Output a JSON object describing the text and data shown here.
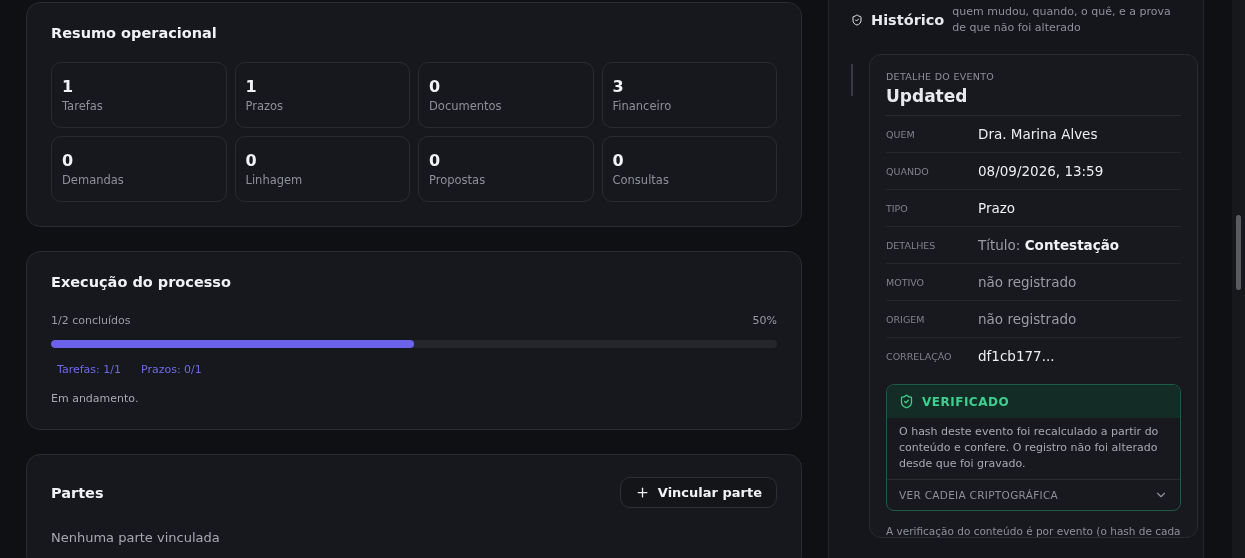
{
  "summary": {
    "title": "Resumo operacional",
    "stats": [
      {
        "value": "1",
        "label": "Tarefas"
      },
      {
        "value": "1",
        "label": "Prazos"
      },
      {
        "value": "0",
        "label": "Documentos"
      },
      {
        "value": "3",
        "label": "Financeiro"
      },
      {
        "value": "0",
        "label": "Demandas"
      },
      {
        "value": "0",
        "label": "Linhagem"
      },
      {
        "value": "0",
        "label": "Propostas"
      },
      {
        "value": "0",
        "label": "Consultas"
      }
    ]
  },
  "execution": {
    "title": "Execução do processo",
    "progress_label": "1/2 concluídos",
    "percent": "50%",
    "level": 0.5,
    "breakdown": [
      "Tarefas: 1/1",
      "Prazos: 0/1"
    ],
    "status": "Em andamento."
  },
  "parties": {
    "title": "Partes",
    "button": "Vincular parte",
    "empty": "Nenhuma parte vinculada"
  },
  "history": {
    "title": "Histórico",
    "subtitle": "quem mudou, quando, o quê, e a prova de que não foi alterado",
    "event": {
      "eyebrow": "DETALHE DO EVENTO",
      "title": "Updated",
      "fields": [
        {
          "label": "QUEM",
          "value": "Dra. Marina Alves",
          "muted": false
        },
        {
          "label": "QUANDO",
          "value": "08/09/2026, 13:59",
          "muted": false
        },
        {
          "label": "TIPO",
          "value": "Prazo",
          "muted": false
        },
        {
          "label": "DETALHES",
          "value": "Título: **Contestação**",
          "muted": true
        },
        {
          "label": "MOTIVO",
          "value": "não registrado",
          "muted": true
        },
        {
          "label": "ORIGEM",
          "value": "não registrado",
          "muted": true
        },
        {
          "label": "CORRELAÇÃO",
          "value": "df1cb177...",
          "muted": false
        }
      ],
      "verification": {
        "status": "VERIFICADO",
        "text": "O hash deste evento foi recalculado a partir do conteúdo e confere. O registro não foi alterado desde que foi gravado.",
        "chain_button": "VER CADEIA CRIPTOGRÁFICA",
        "expanded": false
      }
    },
    "footnote": "A verificação do conteúdo é por evento (o hash de cada"
  }
}
